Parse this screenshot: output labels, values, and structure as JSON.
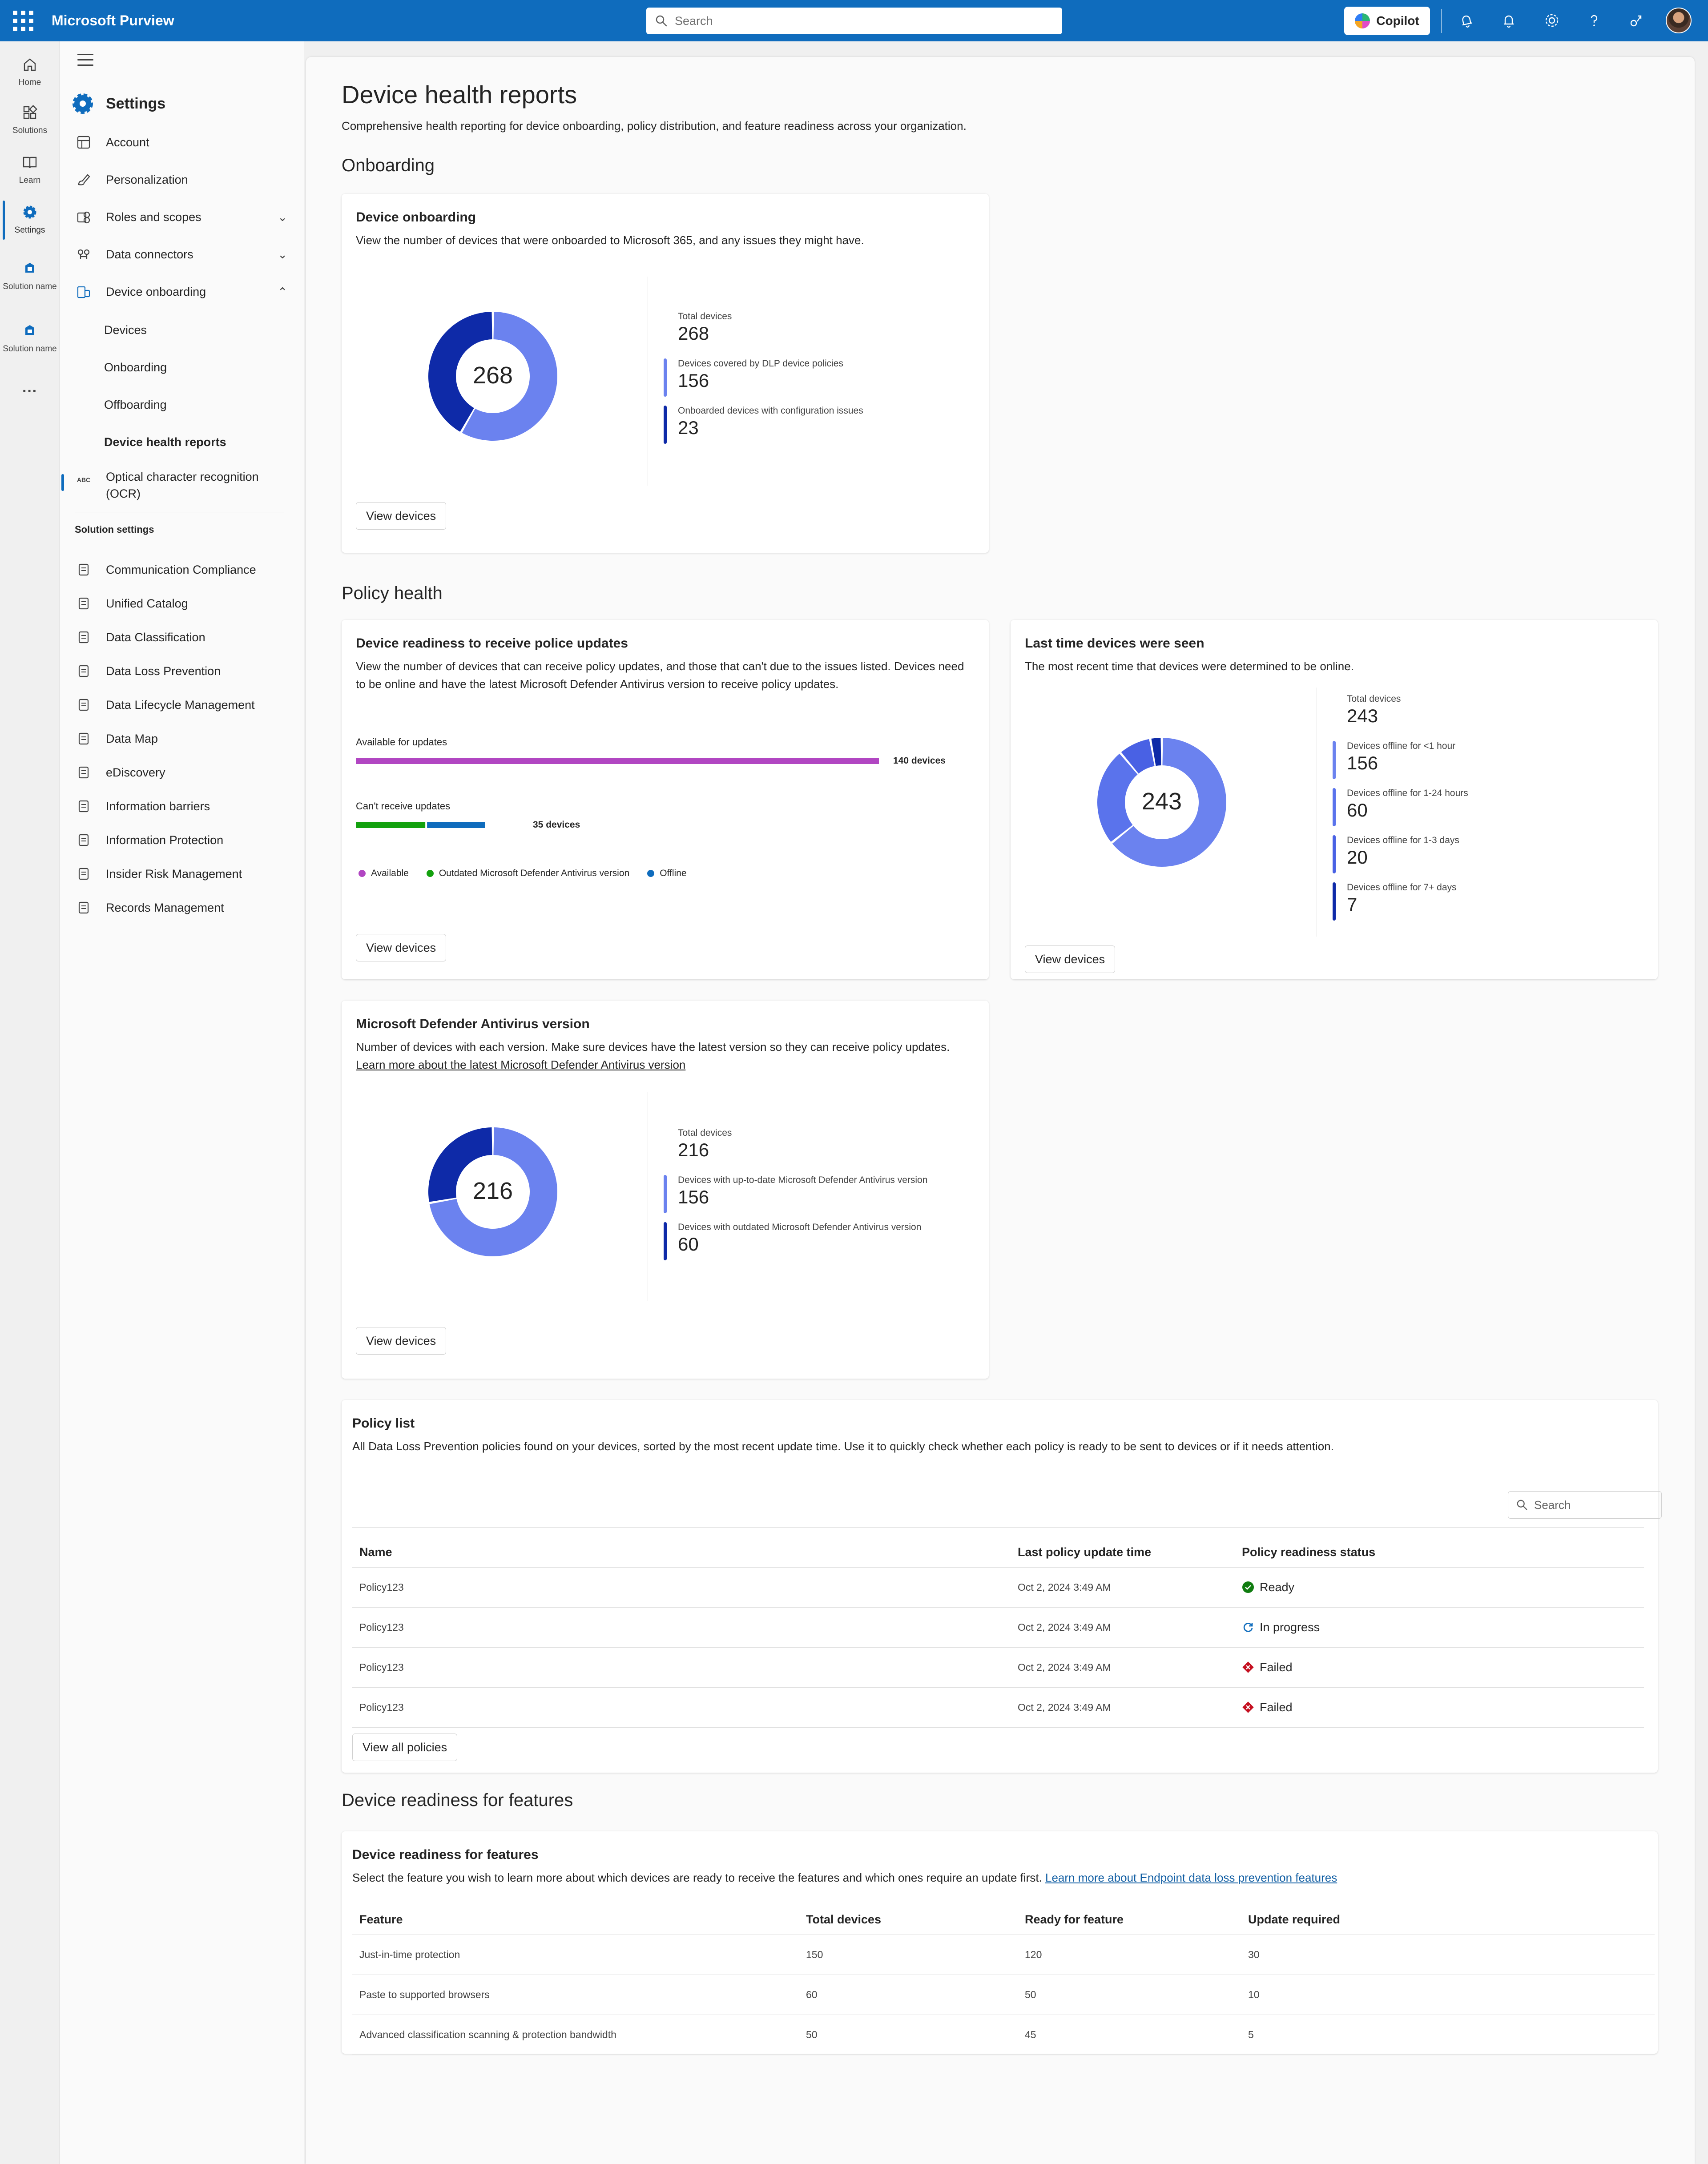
{
  "topbar": {
    "app_title": "Microsoft Purview",
    "search_placeholder": "Search",
    "copilot_label": "Copilot"
  },
  "rail": {
    "items": [
      {
        "label": "Home",
        "icon": "home-icon"
      },
      {
        "label": "Solutions",
        "icon": "solutions-icon"
      },
      {
        "label": "Learn",
        "icon": "book-icon"
      },
      {
        "label": "Settings",
        "icon": "gear-icon"
      },
      {
        "label": "Solution name",
        "icon": "solution-icon"
      },
      {
        "label": "Solution name",
        "icon": "solution-icon"
      }
    ],
    "more": "···"
  },
  "nav": {
    "title": "Settings",
    "items": [
      {
        "label": "Account",
        "icon": "account-icon"
      },
      {
        "label": "Personalization",
        "icon": "brush-icon"
      },
      {
        "label": "Roles and scopes",
        "icon": "roles-icon"
      },
      {
        "label": "Data connectors",
        "icon": "connector-icon"
      },
      {
        "label": "Device onboarding",
        "icon": "device-icon"
      }
    ],
    "sub_items": [
      "Devices",
      "Onboarding",
      "Offboarding",
      "Device health reports"
    ],
    "ocr_label": "Optical character recognition (OCR)",
    "section_title": "Solution settings",
    "solution_items": [
      "Communication Compliance",
      "Unified Catalog",
      "Data Classification",
      "Data Loss Prevention",
      "Data Lifecycle Management",
      "Data Map",
      "eDiscovery",
      "Information barriers",
      "Information Protection",
      "Insider Risk Management",
      "Records Management"
    ]
  },
  "page": {
    "title": "Device health reports",
    "subtitle": "Comprehensive health reporting for device onboarding, policy distribution, and feature readiness across your organization.",
    "sections": {
      "onboarding": "Onboarding",
      "policy_health": "Policy health",
      "feature_readiness": "Device readiness for features"
    }
  },
  "onboarding_card": {
    "title": "Device onboarding",
    "description": "View the number of devices that were onboarded to Microsoft 365, and any issues they might have.",
    "center_value": "268",
    "stats": [
      {
        "label": "Total devices",
        "value": "268"
      },
      {
        "label": "Devices covered by DLP device policies",
        "value": "156"
      },
      {
        "label": "Onboarded devices with configuration issues",
        "value": "23"
      }
    ],
    "button": "View devices"
  },
  "readiness_card": {
    "title": "Device readiness to receive police updates",
    "description": "View the number of devices that can receive policy updates, and those that can't due to the issues listed. Devices need to be online and have the latest Microsoft Defender Antivirus version to receive policy updates.",
    "bars": [
      {
        "label": "Available for updates",
        "value_label": "140 devices"
      },
      {
        "label": "Can't receive updates",
        "value_label": "35 devices"
      }
    ],
    "legend": [
      "Available",
      "Outdated Microsoft Defender Antivirus version",
      "Offline"
    ],
    "button": "View devices"
  },
  "lastseen_card": {
    "title": "Last time devices were seen",
    "description": "The most recent time that devices were determined to be online.",
    "center_value": "243",
    "stats": [
      {
        "label": "Total devices",
        "value": "243"
      },
      {
        "label": "Devices offline for <1 hour",
        "value": "156"
      },
      {
        "label": "Devices offline for 1-24 hours",
        "value": "60"
      },
      {
        "label": "Devices offline for 1-3 days",
        "value": "20"
      },
      {
        "label": "Devices offline for 7+ days",
        "value": "7"
      }
    ],
    "button": "View devices"
  },
  "defender_card": {
    "title": "Microsoft Defender Antivirus version",
    "description": "Number of devices with each version. Make sure devices have the latest version so they can receive policy updates.",
    "link": "Learn more about the latest Microsoft Defender Antivirus version",
    "center_value": "216",
    "stats": [
      {
        "label": "Total devices",
        "value": "216"
      },
      {
        "label": "Devices with up-to-date Microsoft Defender Antivirus version",
        "value": "156"
      },
      {
        "label": "Devices with outdated Microsoft Defender Antivirus version",
        "value": "60"
      }
    ],
    "button": "View devices"
  },
  "policy_list": {
    "title": "Policy list",
    "description": "All Data Loss Prevention policies found on your devices, sorted by the most recent update time. Use it to quickly check whether each policy is ready to be sent to devices or if it needs attention.",
    "search_placeholder": "Search",
    "columns": [
      "Name",
      "Last policy update time",
      "Policy readiness status"
    ],
    "rows": [
      {
        "name": "Policy123",
        "time": "Oct 2, 2024 3:49 AM",
        "status": "Ready",
        "icon": "ready-icon"
      },
      {
        "name": "Policy123",
        "time": "Oct 2, 2024 3:49 AM",
        "status": "In progress",
        "icon": "progress-icon"
      },
      {
        "name": "Policy123",
        "time": "Oct 2, 2024 3:49 AM",
        "status": "Failed",
        "icon": "failed-icon"
      },
      {
        "name": "Policy123",
        "time": "Oct 2, 2024 3:49 AM",
        "status": "Failed",
        "icon": "failed-icon"
      }
    ],
    "button": "View all policies"
  },
  "features_card": {
    "title": "Device readiness for features",
    "description": "Select the feature you wish to learn more about which devices are ready to receive the features and which ones require an update first.",
    "link": "Learn more about Endpoint data loss prevention features",
    "columns": [
      "Feature",
      "Total devices",
      "Ready for feature",
      "Update required"
    ],
    "rows": [
      [
        "Just-in-time protection",
        "150",
        "120",
        "30"
      ],
      [
        "Paste to supported browsers",
        "60",
        "50",
        "10"
      ],
      [
        "Advanced classification scanning & protection bandwidth",
        "50",
        "45",
        "5"
      ]
    ]
  },
  "chart_data": [
    {
      "type": "pie",
      "name": "Device onboarding",
      "series": [
        {
          "name": "Devices covered by DLP device policies",
          "value": 156
        },
        {
          "name": "Onboarded devices with configuration issues",
          "value": 112
        }
      ],
      "colors": [
        "#6b82ef",
        "#0e2aa8"
      ],
      "total": 268
    },
    {
      "type": "bar",
      "name": "Device readiness to receive police updates",
      "categories": [
        "Available for updates",
        "Can't receive updates"
      ],
      "series": [
        {
          "name": "Available",
          "values": [
            140,
            0
          ]
        },
        {
          "name": "Outdated Microsoft Defender Antivirus version",
          "values": [
            0,
            19
          ]
        },
        {
          "name": "Offline",
          "values": [
            0,
            16
          ]
        }
      ],
      "colors": [
        "#b146c2",
        "#13a10e",
        "#0f6cbd"
      ],
      "xlim": [
        0,
        140
      ]
    },
    {
      "type": "pie",
      "name": "Last time devices were seen",
      "series": [
        {
          "name": "Devices offline for <1 hour",
          "value": 156
        },
        {
          "name": "Devices offline for 1-24 hours",
          "value": 60
        },
        {
          "name": "Devices offline for 1-3 days",
          "value": 20
        },
        {
          "name": "Devices offline for 7+ days",
          "value": 7
        }
      ],
      "colors": [
        "#6b82ef",
        "#5a73ec",
        "#4961e4",
        "#0e2aa8"
      ],
      "total": 243
    },
    {
      "type": "pie",
      "name": "Microsoft Defender Antivirus version",
      "series": [
        {
          "name": "Devices with up-to-date Microsoft Defender Antivirus version",
          "value": 156
        },
        {
          "name": "Devices with outdated Microsoft Defender Antivirus version",
          "value": 60
        }
      ],
      "colors": [
        "#6b82ef",
        "#0e2aa8"
      ],
      "total": 216
    }
  ]
}
